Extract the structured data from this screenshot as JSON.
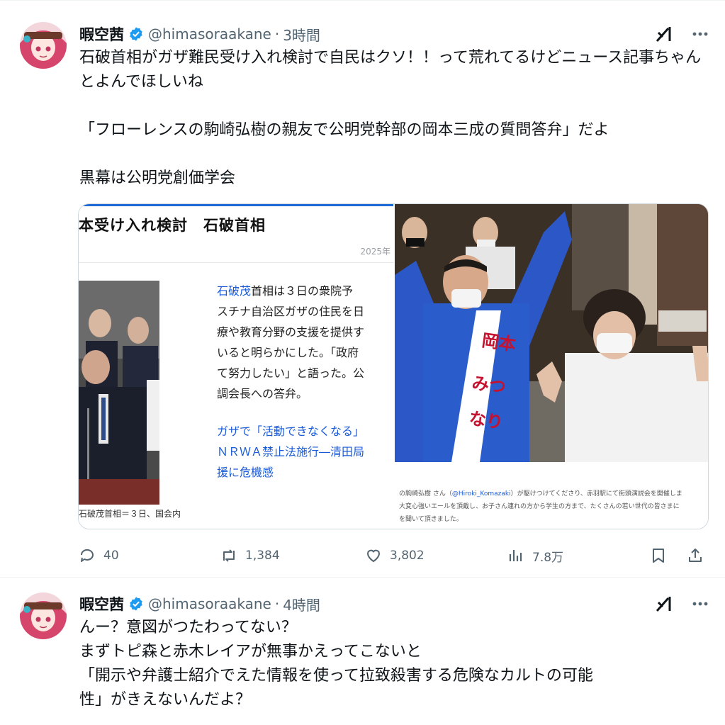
{
  "tweets": [
    {
      "author": {
        "name": "暇空茜",
        "handle": "@himasoraakane",
        "time": "3時間"
      },
      "text": "石破首相がガザ難民受け入れ検討で自民はクソ！！って荒れてるけどニュース記事ちゃんとよんでほしいね\n\n「フローレンスの駒崎弘樹の親友で公明党幹部の岡本三成の質問答弁」だよ\n\n黒幕は公明党創価学会",
      "article": {
        "title": "本受け入れ検討　石破首相",
        "date": "2025年",
        "body_link": "石破茂",
        "body_first": "首相は３日の衆院予",
        "body_rest": "スチナ自治区ガザの住民を日\n療や教育分野の支援を提供す\nいると明らかにした。「政府\nて努力したい」と語った。公\n調会長への答弁。",
        "related_links": "ガザで「活動できなくなる」\nＮＲＷＡ禁止法施行―清田局\n援に危機感",
        "photo_caption": "石破茂首相＝３日、国会内"
      },
      "photo": {
        "sash_text": "岡本 みつなり",
        "caption_pre": "の駒崎弘樹 さん（",
        "caption_link": "@Hiroki_Komazaki",
        "caption_post": "）が駆けつけてくださり、赤羽駅にて街頭演説会を開催しま",
        "caption_line2": "大変心強いエールを頂戴し、お子さん連れの方から学生の方まで、たくさんの若い世代の皆さまに",
        "caption_line3": "を聞いて頂きました。"
      },
      "stats": {
        "replies": "40",
        "reposts": "1,384",
        "likes": "3,802",
        "views": "7.8万"
      }
    },
    {
      "author": {
        "name": "暇空茜",
        "handle": "@himasoraakane",
        "time": "4時間"
      },
      "text": "んー？意図がつたわってない？\nまずトピ森と赤木レイアが無事かえってこないと\n「開示や弁護士紹介でえた情報を使って拉致殺害する危険なカルトの可能\n性」がきえないんだよ？"
    }
  ],
  "colors": {
    "verified": "#1d9bf0",
    "muted": "#536471",
    "link": "#1a5ad7",
    "border": "#cfd9de"
  }
}
